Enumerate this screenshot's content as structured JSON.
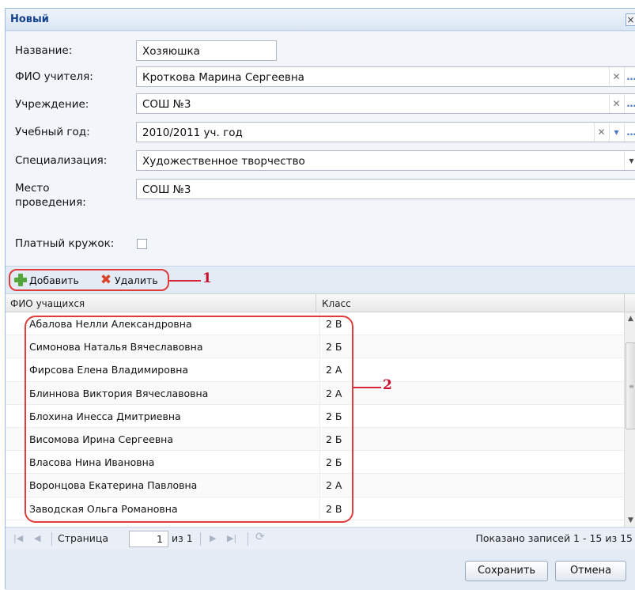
{
  "window": {
    "title": "Новый",
    "close_label": "×"
  },
  "form": {
    "name_label": "Название:",
    "name_value": "Хозяюшка",
    "teacher_label": "ФИО учителя:",
    "teacher_value": "Кроткова Марина Сергеевна",
    "institution_label": "Учреждение:",
    "institution_value": "СОШ №3",
    "year_label": "Учебный год:",
    "year_value": "2010/2011 уч. год",
    "specialization_label": "Специализация:",
    "specialization_value": "Художественное творчество",
    "place_label_line1": "Место",
    "place_label_line2": "проведения:",
    "place_value": "СОШ №3",
    "paid_label": "Платный кружок:",
    "paid_checked": false,
    "icons": {
      "clear": "✕",
      "browse": "…",
      "dropdown": "▾"
    }
  },
  "toolbar": {
    "add_label": "Добавить",
    "delete_label": "Удалить"
  },
  "annotations": {
    "toolbar_number": "1",
    "list_number": "2"
  },
  "grid": {
    "columns": [
      "ФИО учащихся",
      "Класс"
    ],
    "rows": [
      {
        "name": "Абалова Нелли Александровна",
        "class": "2 В"
      },
      {
        "name": "Симонова Наталья Вячеславовна",
        "class": "2 Б"
      },
      {
        "name": "Фирсова Елена Владимировна",
        "class": "2 А"
      },
      {
        "name": "Блиннова Виктория Вячеславовна",
        "class": "2 А"
      },
      {
        "name": "Блохина Инесса Дмитриевна",
        "class": "2 Б"
      },
      {
        "name": "Висомова Ирина Сергеевна",
        "class": "2 Б"
      },
      {
        "name": "Власова Нина Ивановна",
        "class": "2 Б"
      },
      {
        "name": "Воронцова Екатерина Павловна",
        "class": "2 А"
      },
      {
        "name": "Заводская Ольга Романовна",
        "class": "2 В"
      }
    ]
  },
  "pager": {
    "page_label": "Страница",
    "page_value": "1",
    "of_label": "из 1",
    "status": "Показано записей 1 - 15 из 15"
  },
  "footer": {
    "save_label": "Сохранить",
    "cancel_label": "Отмена"
  }
}
